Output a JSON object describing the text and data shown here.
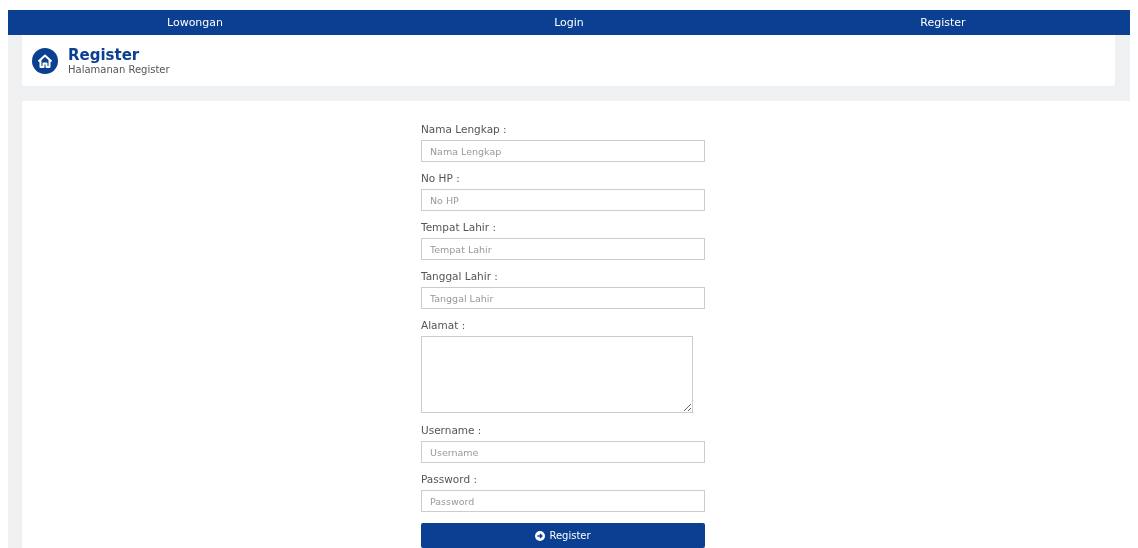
{
  "nav": [
    {
      "label": "Lowongan"
    },
    {
      "label": "Login"
    },
    {
      "label": "Register"
    }
  ],
  "header": {
    "title": "Register",
    "subtitle": "Halamanan Register"
  },
  "form": {
    "fields": [
      {
        "kind": "input",
        "label": "Nama Lengkap :",
        "placeholder": "Nama Lengkap"
      },
      {
        "kind": "input",
        "label": "No HP :",
        "placeholder": "No HP"
      },
      {
        "kind": "input",
        "label": "Tempat Lahir :",
        "placeholder": "Tempat Lahir"
      },
      {
        "kind": "input",
        "label": "Tanggal Lahir :",
        "placeholder": "Tanggal Lahir"
      },
      {
        "kind": "textarea",
        "label": "Alamat :"
      },
      {
        "kind": "input",
        "label": "Username :",
        "placeholder": "Username"
      },
      {
        "kind": "input",
        "label": "Password :",
        "placeholder": "Password"
      }
    ],
    "submit": "Register"
  }
}
